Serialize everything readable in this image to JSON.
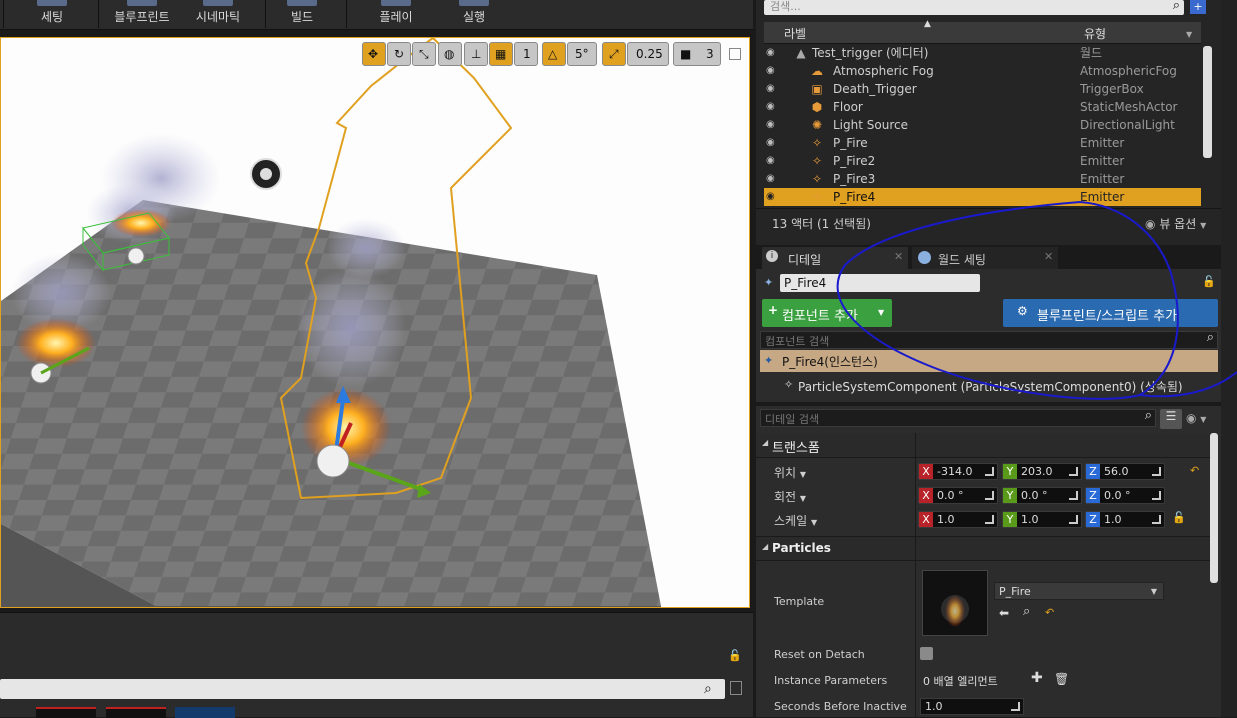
{
  "toolbar": {
    "items": [
      "세팅",
      "블루프린트",
      "시네마틱",
      "빌드",
      "플레이",
      "실행"
    ]
  },
  "viewport": {
    "grid_snap": "1",
    "rotation_snap": "5°",
    "scale_snap": "0.25",
    "camera_speed": "3"
  },
  "outliner": {
    "search_placeholder": "검색...",
    "col_label": "라벨",
    "col_type": "유형",
    "rows": [
      {
        "name": "Test_trigger (에디터)",
        "type": "월드",
        "icon": "world-icon"
      },
      {
        "name": "Atmospheric Fog",
        "type": "AtmosphericFog",
        "icon": "fog-icon"
      },
      {
        "name": "Death_Trigger",
        "type": "TriggerBox",
        "icon": "trigger-icon"
      },
      {
        "name": "Floor",
        "type": "StaticMeshActor",
        "icon": "mesh-icon"
      },
      {
        "name": "Light Source",
        "type": "DirectionalLight",
        "icon": "light-icon"
      },
      {
        "name": "P_Fire",
        "type": "Emitter",
        "icon": "emitter-icon"
      },
      {
        "name": "P_Fire2",
        "type": "Emitter",
        "icon": "emitter-icon"
      },
      {
        "name": "P_Fire3",
        "type": "Emitter",
        "icon": "emitter-icon"
      },
      {
        "name": "P_Fire4",
        "type": "Emitter",
        "icon": "emitter-icon",
        "selected": true
      }
    ],
    "count": "13 액터 (1 선택됨)",
    "view_options": "뷰 옵션"
  },
  "details": {
    "tab_details": "디테일",
    "tab_world": "월드 세팅",
    "actor_name": "P_Fire4",
    "add_component": "컴포넌트 추가",
    "blueprint_button": "블루프린트/스크립트 추가",
    "component_search": "컴포넌트 검색",
    "instance_row": "P_Fire4(인스턴스)",
    "component_row": "ParticleSystemComponent (ParticleSystemComponent0) (상속됨)",
    "detail_search": "디테일 검색",
    "transform_header": "트랜스폼",
    "location_label": "위치",
    "rotation_label": "회전",
    "scale_label": "스케일",
    "location": {
      "x": "-314.0",
      "y": "203.0",
      "z": "56.0"
    },
    "rotation": {
      "x": "0.0 °",
      "y": "0.0 °",
      "z": "0.0 °"
    },
    "scale": {
      "x": "1.0",
      "y": "1.0",
      "z": "1.0"
    },
    "particles_header": "Particles",
    "template_label": "Template",
    "template_value": "P_Fire",
    "reset_label": "Reset on Detach",
    "instance_params_label": "Instance Parameters",
    "instance_params_value": "0 배열 엘리먼트",
    "seconds_label": "Seconds Before Inactive",
    "seconds_value": "1.0"
  },
  "colors": {
    "accent": "#e0a020",
    "selection": "#e0a020",
    "annotation": "#1a1acc"
  }
}
